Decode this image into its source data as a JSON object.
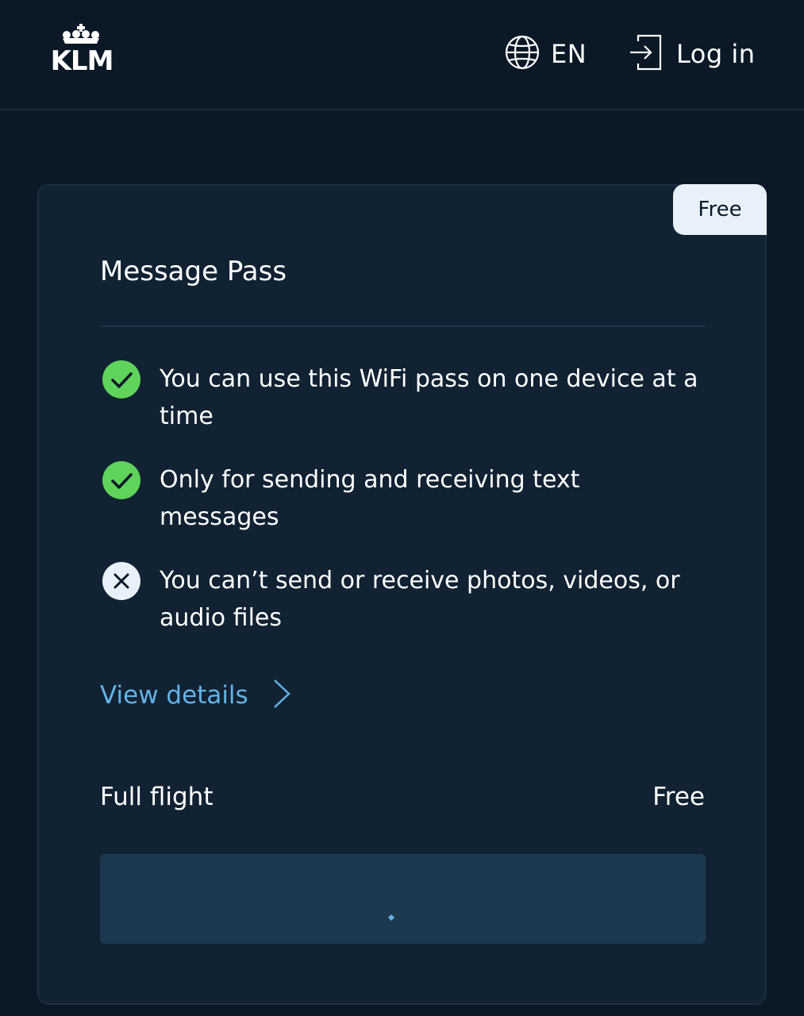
{
  "header": {
    "logo_text": "KLM",
    "language": "EN",
    "login_label": "Log in"
  },
  "pass_card": {
    "badge": "Free",
    "title": "Message Pass",
    "features": [
      {
        "status": "included",
        "icon": "check-circle-icon",
        "text": "You can use this WiFi pass on one device at a time"
      },
      {
        "status": "included",
        "icon": "check-circle-icon",
        "text": "Only for sending and receiving text messages"
      },
      {
        "status": "excluded",
        "icon": "x-circle-icon",
        "text": "You can’t send or receive photos, videos, or audio files"
      }
    ],
    "details_link": "View details",
    "price_label": "Full flight",
    "price_value": "Free",
    "cta_state": "loading"
  },
  "colors": {
    "background": "#0b1926",
    "card": "#112232",
    "accent_link": "#62b3e8",
    "check_green": "#5fd35a",
    "cta": "#1c3950"
  }
}
